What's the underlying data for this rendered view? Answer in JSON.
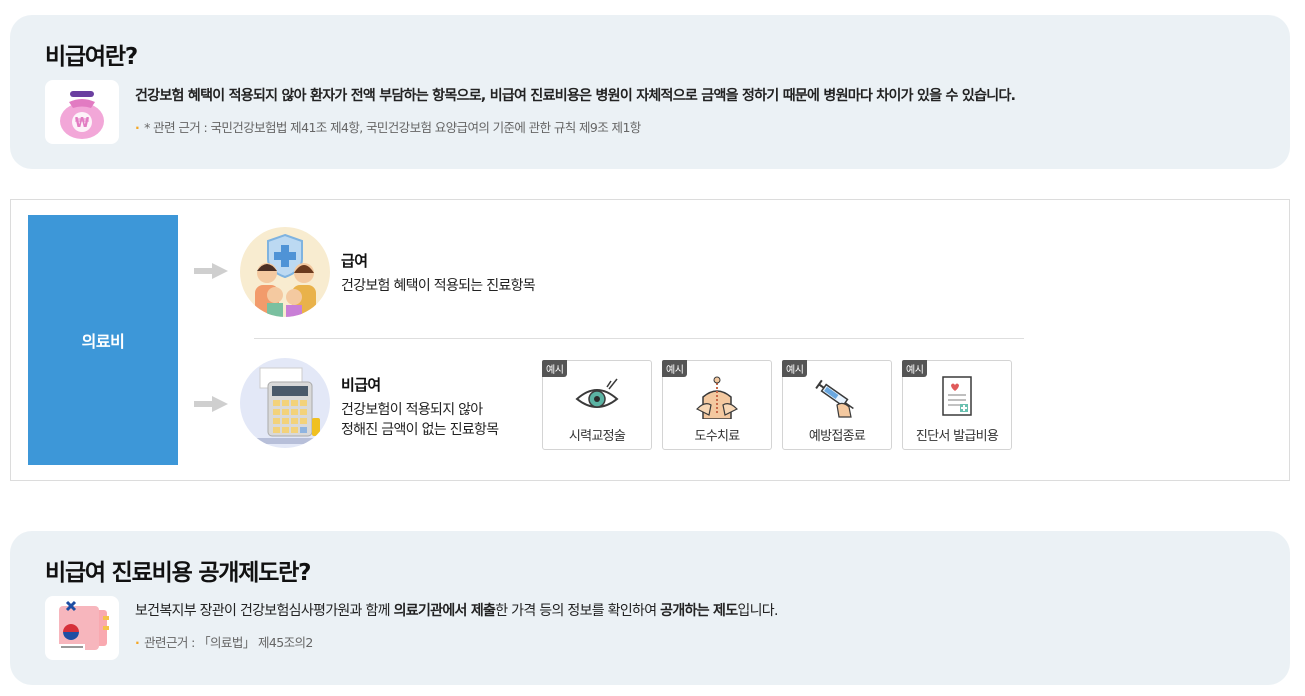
{
  "section1": {
    "title": "비급여란?",
    "description": "건강보험 혜택이 적용되지 않아 환자가 전액 부담하는 항목으로, 비급여 진료비용은 병원이 자체적으로 금액을 정하기 때문에 병원마다 차이가 있을 수 있습니다.",
    "note": "* 관련 근거 : 국민건강보험법 제41조 제4항, 국민건강보험 요양급여의 기준에 관한 규칙 제9조 제1항",
    "icon": "money-bag-icon",
    "icon_symbol": "₩"
  },
  "diagram": {
    "root_label": "의료비",
    "covered": {
      "title": "급여",
      "description": "건강보험 혜택이 적용되는 진료항목"
    },
    "non_covered": {
      "title": "비급여",
      "description_line1": "건강보험이 적용되지 않아",
      "description_line2": "정해진 금액이 없는 진료항목"
    },
    "example_tag": "예시",
    "examples": [
      {
        "label": "시력교정술",
        "icon": "eye-icon"
      },
      {
        "label": "도수치료",
        "icon": "manual-therapy-icon"
      },
      {
        "label": "예방접종료",
        "icon": "syringe-icon"
      },
      {
        "label": "진단서 발급비용",
        "icon": "certificate-icon"
      }
    ]
  },
  "section2": {
    "title": "비급여 진료비용 공개제도란?",
    "desc_part1": "보건복지부 장관이 건강보험심사평가원과 함께 ",
    "desc_bold1": "의료기관에서 제출",
    "desc_part2": "한 가격 등의 정보를 확인하여 ",
    "desc_bold2": "공개하는 제도",
    "desc_part3": "입니다.",
    "note": "관련근거 : 「의료법」 제45조의2",
    "icon": "ministry-document-icon"
  },
  "colors": {
    "panel_bg": "#ebf1f5",
    "accent_blue": "#3d97d8",
    "bullet_orange": "#f5a623"
  }
}
